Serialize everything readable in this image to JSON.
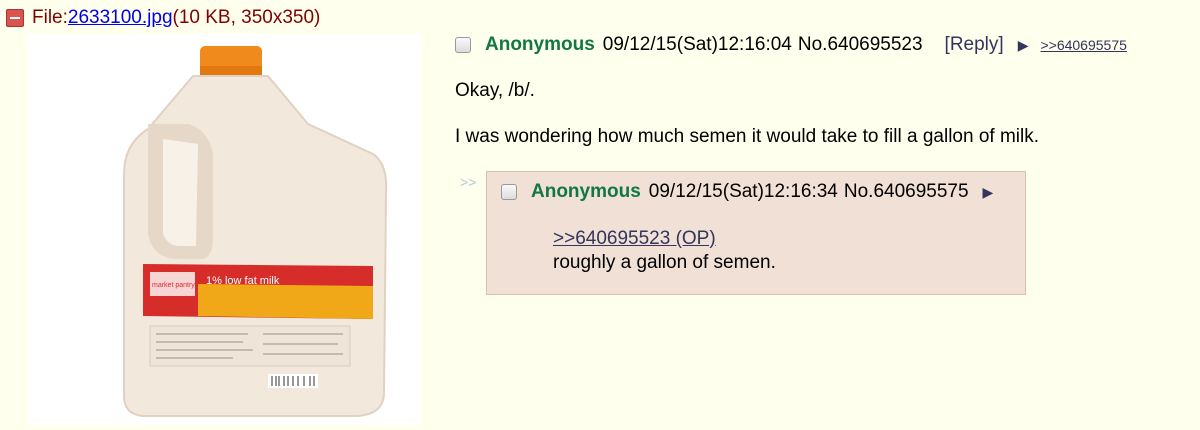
{
  "file": {
    "prefix": "File: ",
    "name": "2633100.jpg",
    "meta": " (10 KB, 350x350)"
  },
  "thumbnail": {
    "label_text": "1% low fat milk",
    "brand": "market pantry",
    "colors": {
      "cap": "#f08a1c",
      "jug": "#f2e8dc",
      "label": "#d62d2a"
    }
  },
  "op": {
    "name": "Anonymous",
    "datetime": "09/12/15(Sat)12:16:04",
    "number": "No.640695523",
    "reply_label": "[Reply]",
    "backlink": ">>640695575",
    "lines": [
      "Okay, /b/.",
      "I was wondering how much semen it would take to fill a gallon of milk."
    ]
  },
  "reply": {
    "marker": ">>",
    "name": "Anonymous",
    "datetime": "09/12/15(Sat)12:16:34",
    "number": "No.640695575",
    "quote": ">>640695523 (OP)",
    "text": "roughly a gallon of semen."
  },
  "colors": {
    "background": "#ffffee",
    "reply_background": "#f0e0d6",
    "name_green": "#117743",
    "link_blue": "#34345c"
  }
}
